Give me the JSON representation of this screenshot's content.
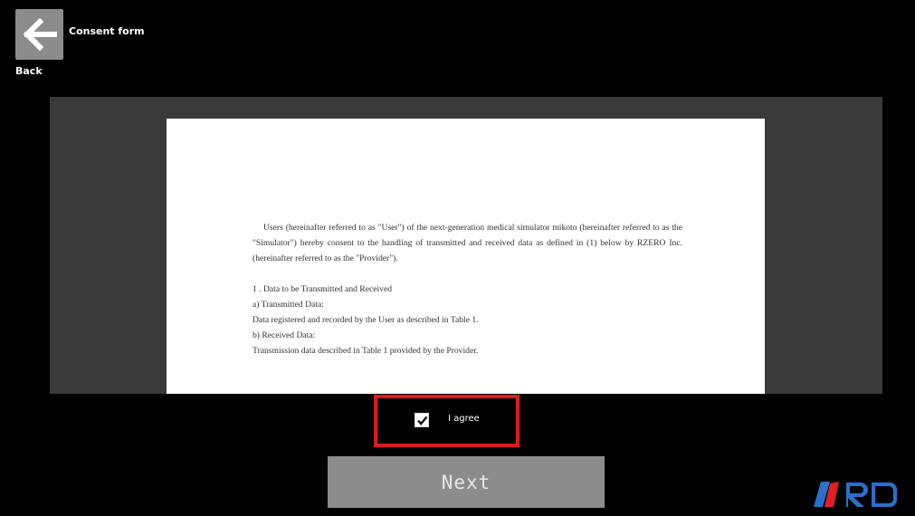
{
  "header": {
    "back_label": "Back",
    "title": "Consent form"
  },
  "document": {
    "paragraphs": [
      "Users (hereinafter referred to as \"User\") of the next-generation medical simulator mikoto (hereinafter referred to as the \"Simulator\") hereby consent to the handling of transmitted and received data as defined in (1) below by RZERO Inc. (hereinafter referred to as the \"Provider\").",
      "",
      "1 . Data to be Transmitted and Received",
      "a) Transmitted Data:",
      "Data registered and recorded by the User as described in Table 1.",
      "b) Received Data:",
      "Transmission data described in Table 1 provided by the Provider."
    ]
  },
  "consent": {
    "label": "I agree",
    "checked": true
  },
  "footer": {
    "next_label": "Next"
  },
  "colors": {
    "highlight": "#e01a1a",
    "logo_red": "#e02020",
    "logo_blue": "#2a6fc9"
  }
}
